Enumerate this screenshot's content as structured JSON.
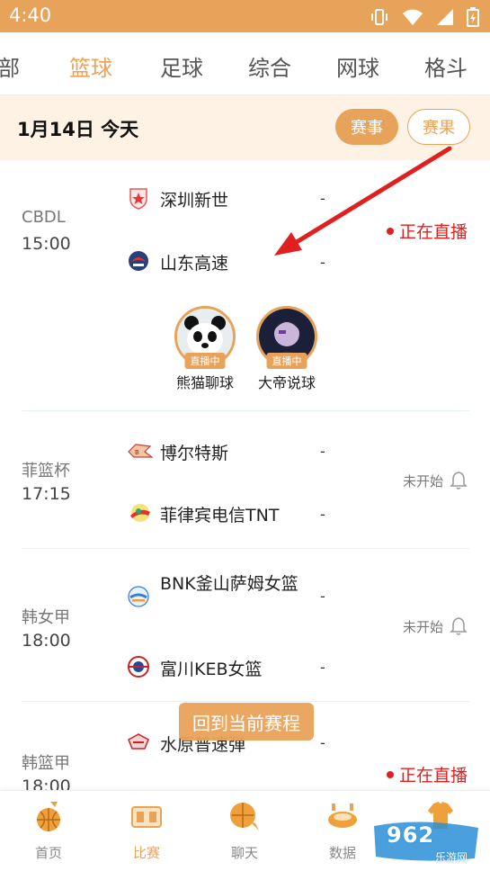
{
  "status_bar": {
    "time": "4:40"
  },
  "category_tabs": [
    {
      "label": "全部",
      "visible_label": "部"
    },
    {
      "label": "篮球"
    },
    {
      "label": "足球"
    },
    {
      "label": "综合"
    },
    {
      "label": "网球"
    },
    {
      "label": "格斗"
    }
  ],
  "date_bar": {
    "date": "1月14日 今天",
    "events_label": "赛事",
    "results_label": "赛果"
  },
  "matches": [
    {
      "league": "CBDL",
      "time": "15:00",
      "home": {
        "name": "深圳新世",
        "score": "-"
      },
      "away": {
        "name": "山东高速",
        "score": "-"
      },
      "status": "正在直播",
      "streamers": [
        {
          "name": "熊猫聊球",
          "tag": "直播中"
        },
        {
          "name": "大帝说球",
          "tag": "直播中"
        }
      ]
    },
    {
      "league": "菲篮杯",
      "time": "17:15",
      "home": {
        "name": "博尔特斯",
        "score": "-"
      },
      "away": {
        "name": "菲律宾电信TNT",
        "score": "-"
      },
      "status": "未开始"
    },
    {
      "league": "韩女甲",
      "time": "18:00",
      "home": {
        "name": "BNK釜山萨姆女篮",
        "score": "-"
      },
      "away": {
        "name": "富川KEB女篮",
        "score": "-"
      },
      "status": "未开始"
    },
    {
      "league": "韩篮甲",
      "time": "18:00",
      "home": {
        "name": "水原普速弹",
        "score": "-"
      },
      "status": "正在直播"
    }
  ],
  "back_to_current": "回到当前赛程",
  "bottom_nav": [
    {
      "label": "首页"
    },
    {
      "label": "比赛"
    },
    {
      "label": "聊天"
    },
    {
      "label": "数据"
    },
    {
      "label": ""
    }
  ],
  "watermark": {
    "text": "962",
    "sub": "乐游网"
  },
  "colors": {
    "accent": "#e8a35a",
    "live": "#e02020",
    "date_bar_bg": "#fdf2e4"
  }
}
